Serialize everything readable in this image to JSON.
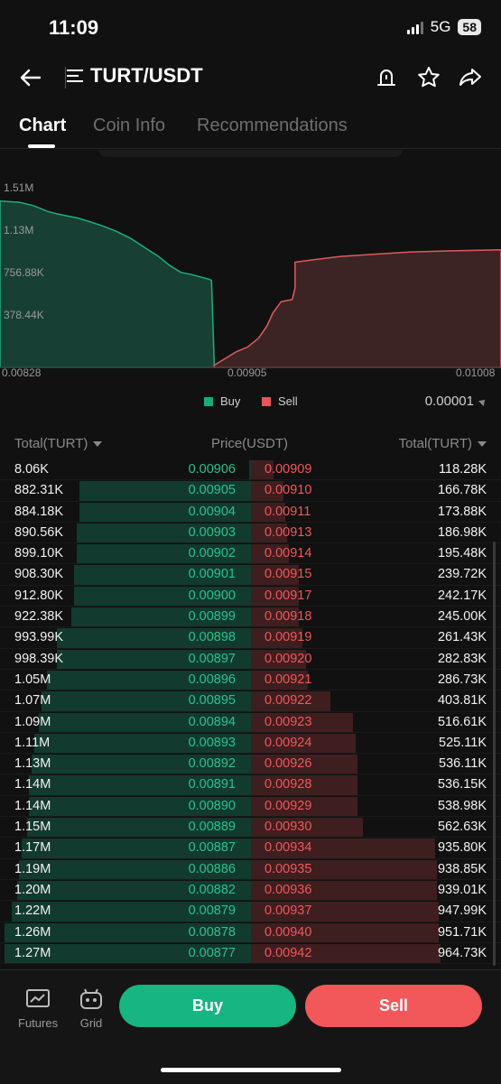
{
  "status": {
    "time": "11:09",
    "network": "5G",
    "battery": "58"
  },
  "header": {
    "pair": "TURT/USDT"
  },
  "tabs": [
    "Chart",
    "Coin Info",
    "Recommendations"
  ],
  "chart_data": {
    "type": "area",
    "x_ticks": [
      "0.00828",
      "0.00905",
      "0.01008"
    ],
    "y_ticks": [
      "1.51M",
      "1.13M",
      "756.88K",
      "378.44K"
    ],
    "xlim": [
      0.00828,
      0.01008
    ],
    "ylim": [
      0,
      1.7
    ],
    "series": [
      {
        "name": "Buy",
        "color": "#1fae7d",
        "points": [
          [
            0.00828,
            1.47
          ],
          [
            0.00835,
            1.46
          ],
          [
            0.0084,
            1.43
          ],
          [
            0.00845,
            1.38
          ],
          [
            0.00848,
            1.36
          ],
          [
            0.00852,
            1.34
          ],
          [
            0.00856,
            1.32
          ],
          [
            0.0086,
            1.29
          ],
          [
            0.00865,
            1.25
          ],
          [
            0.0087,
            1.2
          ],
          [
            0.00875,
            1.14
          ],
          [
            0.0088,
            1.06
          ],
          [
            0.00885,
            0.98
          ],
          [
            0.00889,
            0.9
          ],
          [
            0.00893,
            0.84
          ],
          [
            0.00897,
            0.82
          ],
          [
            0.009,
            0.8
          ],
          [
            0.00903,
            0.78
          ],
          [
            0.00904,
            0.77
          ],
          [
            0.00905,
            0.01
          ]
        ]
      },
      {
        "name": "Sell",
        "color": "#e05a5c",
        "points": [
          [
            0.00905,
            0.02
          ],
          [
            0.00909,
            0.08
          ],
          [
            0.00913,
            0.14
          ],
          [
            0.00917,
            0.18
          ],
          [
            0.00921,
            0.26
          ],
          [
            0.00924,
            0.37
          ],
          [
            0.00926,
            0.48
          ],
          [
            0.00929,
            0.58
          ],
          [
            0.00933,
            0.6
          ],
          [
            0.00934,
            0.7
          ],
          [
            0.00934,
            0.93
          ],
          [
            0.0094,
            0.95
          ],
          [
            0.0095,
            0.98
          ],
          [
            0.00962,
            1.0
          ],
          [
            0.00975,
            1.02
          ],
          [
            0.0099,
            1.03
          ],
          [
            0.01008,
            1.04
          ]
        ]
      }
    ]
  },
  "legend": {
    "buy": "Buy",
    "sell": "Sell",
    "buy_color": "#19a97b",
    "sell_color": "#e85457"
  },
  "precision": "0.00001",
  "book_headers": {
    "left": "Total(TURT)",
    "middle": "Price(USDT)",
    "right": "Total(TURT)"
  },
  "book": [
    {
      "btot": "8.06K",
      "bpx": "0.00906",
      "apx": "0.00909",
      "atot": "118.28K",
      "bf": 0.006,
      "af": 0.12
    },
    {
      "btot": "882.31K",
      "bpx": "0.00905",
      "apx": "0.00910",
      "atot": "166.78K",
      "bf": 0.69,
      "af": 0.17
    },
    {
      "btot": "884.18K",
      "bpx": "0.00904",
      "apx": "0.00911",
      "atot": "173.88K",
      "bf": 0.69,
      "af": 0.18
    },
    {
      "btot": "890.56K",
      "bpx": "0.00903",
      "apx": "0.00913",
      "atot": "186.98K",
      "bf": 0.7,
      "af": 0.19
    },
    {
      "btot": "899.10K",
      "bpx": "0.00902",
      "apx": "0.00914",
      "atot": "195.48K",
      "bf": 0.7,
      "af": 0.2
    },
    {
      "btot": "908.30K",
      "bpx": "0.00901",
      "apx": "0.00915",
      "atot": "239.72K",
      "bf": 0.71,
      "af": 0.25
    },
    {
      "btot": "912.80K",
      "bpx": "0.00900",
      "apx": "0.00917",
      "atot": "242.17K",
      "bf": 0.71,
      "af": 0.25
    },
    {
      "btot": "922.38K",
      "bpx": "0.00899",
      "apx": "0.00918",
      "atot": "245.00K",
      "bf": 0.72,
      "af": 0.25
    },
    {
      "btot": "993.99K",
      "bpx": "0.00898",
      "apx": "0.00919",
      "atot": "261.43K",
      "bf": 0.78,
      "af": 0.27
    },
    {
      "btot": "998.39K",
      "bpx": "0.00897",
      "apx": "0.00920",
      "atot": "282.83K",
      "bf": 0.78,
      "af": 0.29
    },
    {
      "btot": "1.05M",
      "bpx": "0.00896",
      "apx": "0.00921",
      "atot": "286.73K",
      "bf": 0.82,
      "af": 0.3
    },
    {
      "btot": "1.07M",
      "bpx": "0.00895",
      "apx": "0.00922",
      "atot": "403.81K",
      "bf": 0.84,
      "af": 0.42
    },
    {
      "btot": "1.09M",
      "bpx": "0.00894",
      "apx": "0.00923",
      "atot": "516.61K",
      "bf": 0.85,
      "af": 0.54
    },
    {
      "btot": "1.11M",
      "bpx": "0.00893",
      "apx": "0.00924",
      "atot": "525.11K",
      "bf": 0.87,
      "af": 0.55
    },
    {
      "btot": "1.13M",
      "bpx": "0.00892",
      "apx": "0.00926",
      "atot": "536.11K",
      "bf": 0.88,
      "af": 0.56
    },
    {
      "btot": "1.14M",
      "bpx": "0.00891",
      "apx": "0.00928",
      "atot": "536.15K",
      "bf": 0.89,
      "af": 0.56
    },
    {
      "btot": "1.14M",
      "bpx": "0.00890",
      "apx": "0.00929",
      "atot": "538.98K",
      "bf": 0.89,
      "af": 0.56
    },
    {
      "btot": "1.15M",
      "bpx": "0.00889",
      "apx": "0.00930",
      "atot": "562.63K",
      "bf": 0.9,
      "af": 0.59
    },
    {
      "btot": "1.17M",
      "bpx": "0.00887",
      "apx": "0.00934",
      "atot": "935.80K",
      "bf": 0.92,
      "af": 0.97
    },
    {
      "btot": "1.19M",
      "bpx": "0.00886",
      "apx": "0.00935",
      "atot": "938.85K",
      "bf": 0.93,
      "af": 0.98
    },
    {
      "btot": "1.20M",
      "bpx": "0.00882",
      "apx": "0.00936",
      "atot": "939.01K",
      "bf": 0.94,
      "af": 0.98
    },
    {
      "btot": "1.22M",
      "bpx": "0.00879",
      "apx": "0.00937",
      "atot": "947.99K",
      "bf": 0.96,
      "af": 0.99
    },
    {
      "btot": "1.26M",
      "bpx": "0.00878",
      "apx": "0.00940",
      "atot": "951.71K",
      "bf": 0.99,
      "af": 0.99
    },
    {
      "btot": "1.27M",
      "bpx": "0.00877",
      "apx": "0.00942",
      "atot": "964.73K",
      "bf": 0.99,
      "af": 1.0
    }
  ],
  "bottom_nav": {
    "futures": "Futures",
    "grid": "Grid"
  },
  "actions": {
    "buy": "Buy",
    "sell": "Sell"
  }
}
